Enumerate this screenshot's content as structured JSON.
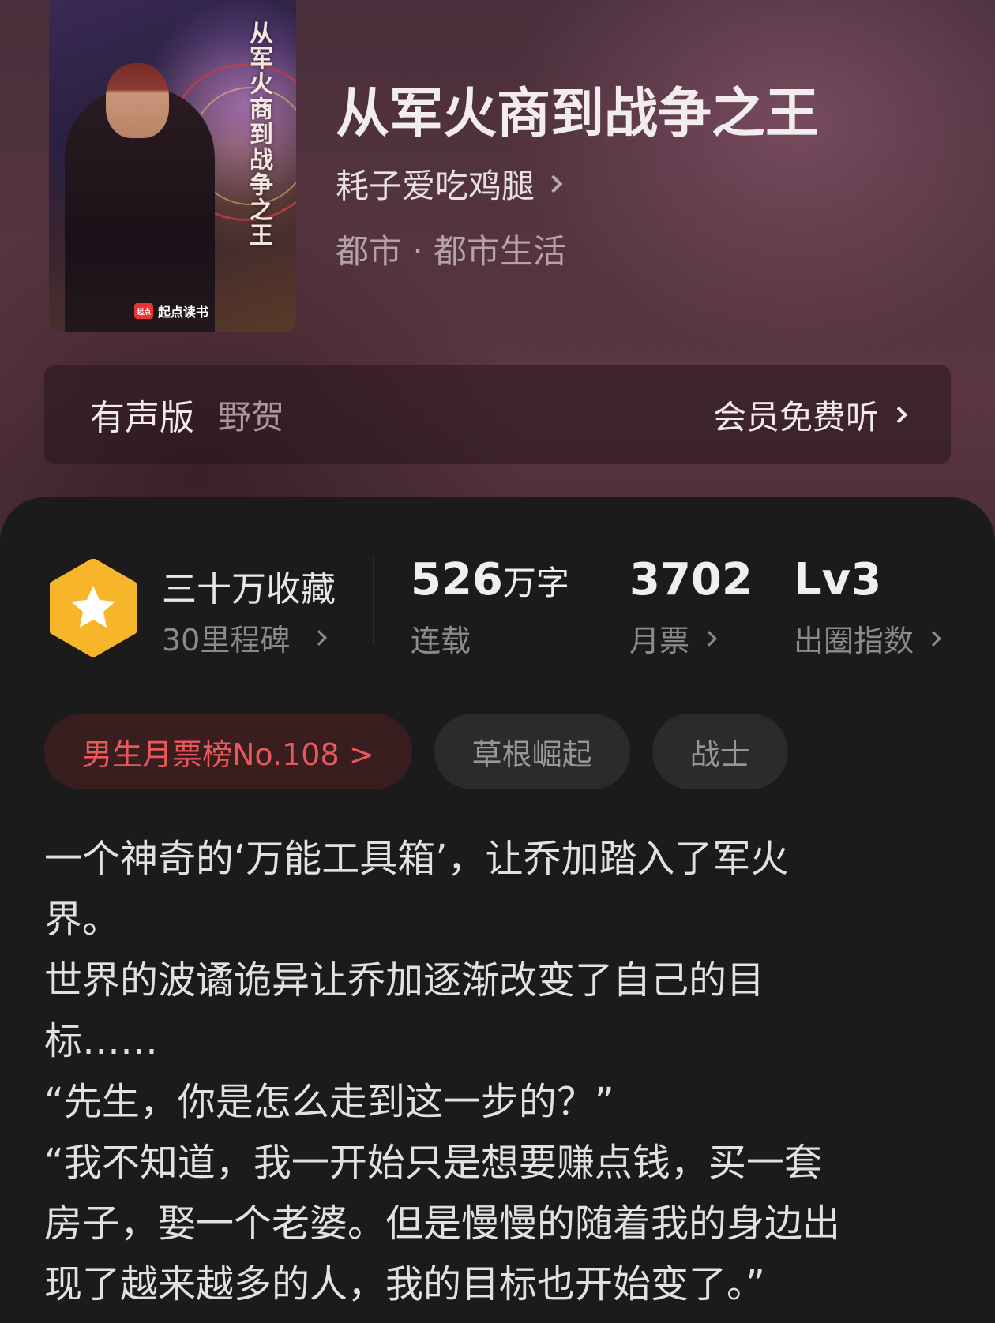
{
  "book": {
    "cover_title": "从军火商到战争之王",
    "cover_brand": "起点读书",
    "cover_logo_text": "起点",
    "title": "从军火商到战争之王",
    "author": "耗子爱吃鸡腿",
    "genre": "都市 · 都市生活"
  },
  "audio": {
    "label": "有声版",
    "narrator": "野贺",
    "cta": "会员免费听"
  },
  "stats": {
    "milestone_title": "三十万收藏",
    "milestone_sub": "30里程碑",
    "word_count": "526",
    "word_unit": "万字",
    "word_label": "连载",
    "monthly_votes": "3702",
    "monthly_votes_label": "月票",
    "level": "Lv3",
    "level_label": "出圈指数"
  },
  "tags": [
    {
      "label": "男生月票榜No.108 >"
    },
    {
      "label": "草根崛起"
    },
    {
      "label": "战士"
    }
  ],
  "synopsis": [
    "一个神奇的‘万能工具箱’，让乔加踏入了军火",
    "界。",
    "世界的波谲诡异让乔加逐渐改变了自己的目",
    "标……",
    "“先生，你是怎么走到这一步的？”",
    "“我不知道，我一开始只是想要赚点钱，买一套",
    "房子，娶一个老婆。但是慢慢的随着我的身边出",
    "现了越来越多的人，我的目标也开始变了。”"
  ],
  "colors": {
    "badge": "#f7b52a",
    "rank_tag_text": "#e85a5a",
    "rank_tag_bg": "#3a1d1f"
  }
}
